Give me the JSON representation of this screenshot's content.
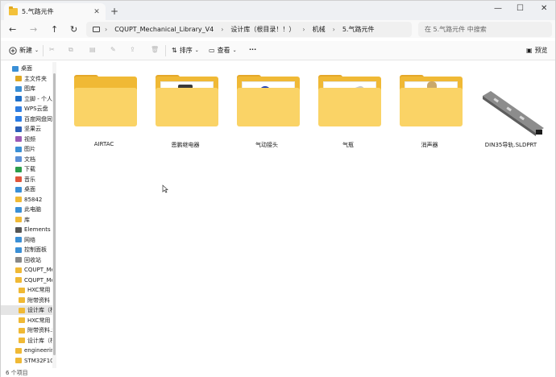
{
  "window": {
    "tab_title": "5.气路元件",
    "tab_close": "✕",
    "new_tab": "+",
    "minimize": "—",
    "maximize": "☐",
    "close": "✕"
  },
  "nav": {
    "back": "←",
    "forward": "→",
    "up": "↑",
    "refresh": "↻"
  },
  "breadcrumb": {
    "items": [
      "CQUPT_Mechanical_Library_V4",
      "设计库（根目录！！）",
      "机械",
      "5.气路元件"
    ],
    "separator": "›"
  },
  "search": {
    "placeholder": "在 5.气路元件 中搜索"
  },
  "toolbar": {
    "new_label": "新建",
    "sort_label": "排序",
    "view_label": "查看",
    "more_label": "···",
    "preview_label": "预览"
  },
  "sidebar": {
    "items": [
      {
        "label": "桌面",
        "color": "#3a8fd6"
      },
      {
        "label": "主文件夹",
        "color": "#e0a822"
      },
      {
        "label": "图库",
        "color": "#3a8fd6"
      },
      {
        "label": "立脚 - 个人",
        "color": "#1e6fc9"
      },
      {
        "label": "WPS云盘",
        "color": "#2f7de1"
      },
      {
        "label": "百度网盘同步",
        "color": "#2a7be4"
      },
      {
        "label": "坚果云",
        "color": "#2b5fb8"
      },
      {
        "label": "视频",
        "color": "#9b59b6"
      },
      {
        "label": "图片",
        "color": "#3a8fd6"
      },
      {
        "label": "文档",
        "color": "#5b8fd6"
      },
      {
        "label": "下载",
        "color": "#2a9d4a"
      },
      {
        "label": "音乐",
        "color": "#e0553a"
      },
      {
        "label": "桌面",
        "color": "#3a8fd6"
      },
      {
        "label": "85842",
        "color": "#f0b935"
      },
      {
        "label": "此电脑",
        "color": "#3a8fd6"
      },
      {
        "label": "库",
        "color": "#f0b935"
      },
      {
        "label": "Elements (I",
        "color": "#555555"
      },
      {
        "label": "网络",
        "color": "#3a8fd6"
      },
      {
        "label": "控制面板",
        "color": "#3a8fd6"
      },
      {
        "label": "回收站",
        "color": "#888888"
      },
      {
        "label": "CQUPT_Me",
        "color": "#f0b935"
      },
      {
        "label": "CQUPT_Me",
        "color": "#f0b935"
      },
      {
        "label": "HXC常用",
        "color": "#f0b935"
      },
      {
        "label": "附带资料",
        "color": "#f0b935"
      },
      {
        "label": "设计库（根",
        "color": "#f0b935"
      },
      {
        "label": "HXC常用",
        "color": "#f0b935"
      },
      {
        "label": "附带资料.z",
        "color": "#f0b935"
      },
      {
        "label": "设计库（根",
        "color": "#f0b935"
      },
      {
        "label": "engineerin",
        "color": "#f0b935"
      },
      {
        "label": "STM32F10",
        "color": "#f0b935"
      }
    ]
  },
  "files": [
    {
      "name": "AIRTAC",
      "type": "folder"
    },
    {
      "name": "恩鹏继电器",
      "type": "folder"
    },
    {
      "name": "气动接头",
      "type": "folder"
    },
    {
      "name": "气瓶",
      "type": "folder"
    },
    {
      "name": "消声器",
      "type": "folder"
    },
    {
      "name": "DIN35导轨.SLDPRT",
      "type": "file"
    }
  ],
  "status": {
    "count": "6 个项目"
  }
}
